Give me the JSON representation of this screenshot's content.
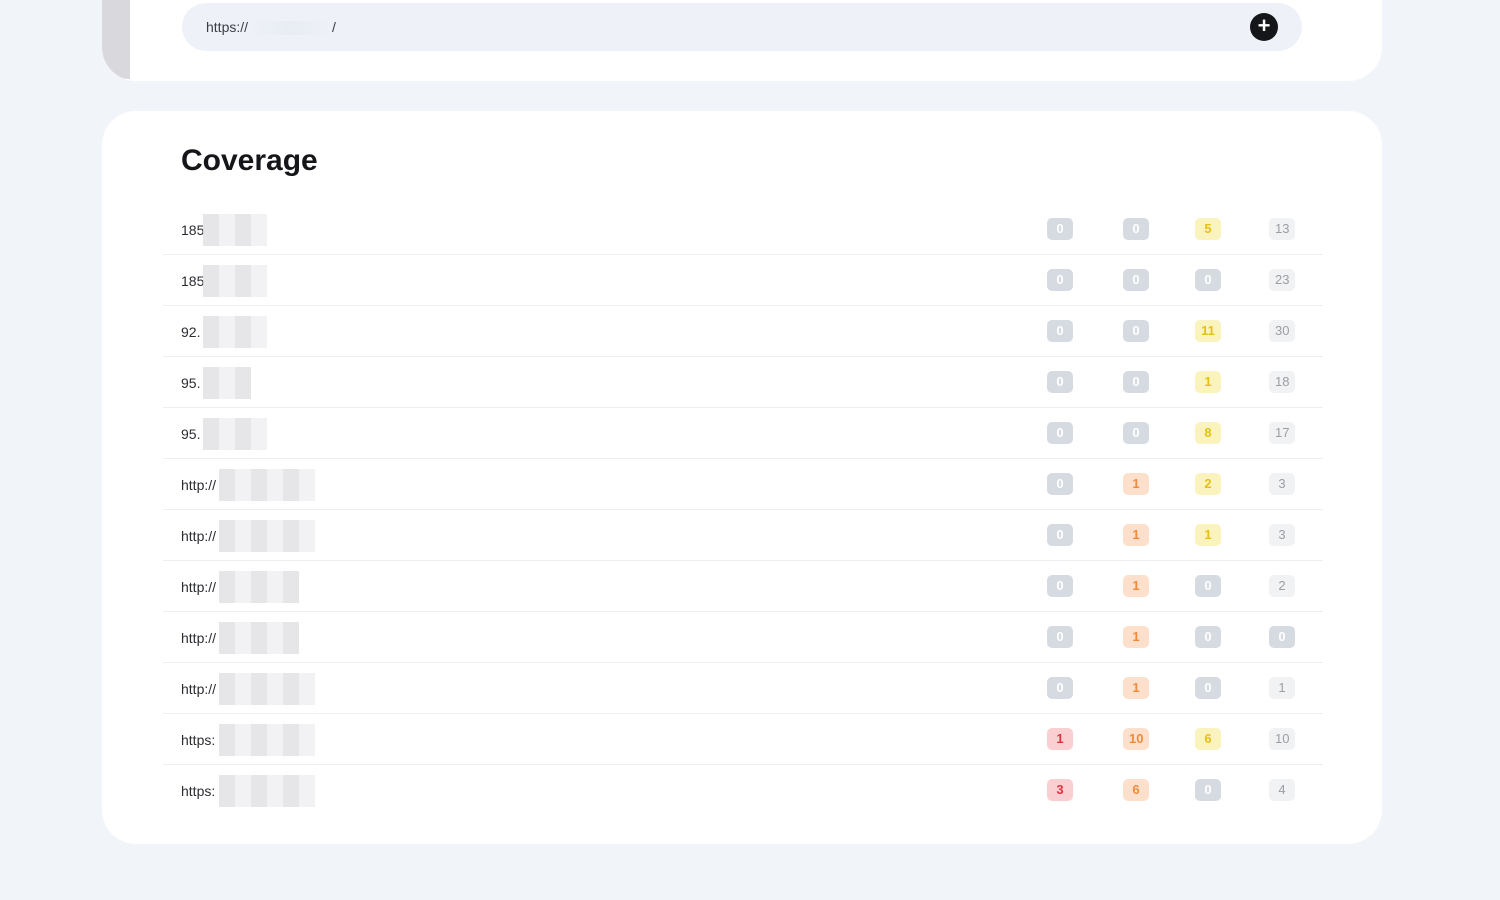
{
  "top": {
    "url_prefix": "https://",
    "url_suffix": "/",
    "add_button": "+"
  },
  "coverage": {
    "title": "Coverage",
    "rows": [
      {
        "label": "185",
        "c1": "0",
        "c2": "0",
        "c3": "5",
        "c4": "13",
        "t1": "gray",
        "t2": "gray",
        "t3": "yellow",
        "t4": "light"
      },
      {
        "label": "185",
        "c1": "0",
        "c2": "0",
        "c3": "0",
        "c4": "23",
        "t1": "gray",
        "t2": "gray",
        "t3": "gray",
        "t4": "light"
      },
      {
        "label": "92.",
        "c1": "0",
        "c2": "0",
        "c3": "11",
        "c4": "30",
        "t1": "gray",
        "t2": "gray",
        "t3": "yellow",
        "t4": "light"
      },
      {
        "label": "95.",
        "c1": "0",
        "c2": "0",
        "c3": "1",
        "c4": "18",
        "t1": "gray",
        "t2": "gray",
        "t3": "yellow",
        "t4": "light"
      },
      {
        "label": "95.",
        "c1": "0",
        "c2": "0",
        "c3": "8",
        "c4": "17",
        "t1": "gray",
        "t2": "gray",
        "t3": "yellow",
        "t4": "light"
      },
      {
        "label": "http://",
        "c1": "0",
        "c2": "1",
        "c3": "2",
        "c4": "3",
        "t1": "gray",
        "t2": "orange",
        "t3": "yellow",
        "t4": "light"
      },
      {
        "label": "http://",
        "c1": "0",
        "c2": "1",
        "c3": "1",
        "c4": "3",
        "t1": "gray",
        "t2": "orange",
        "t3": "yellow",
        "t4": "light"
      },
      {
        "label": "http://",
        "c1": "0",
        "c2": "1",
        "c3": "0",
        "c4": "2",
        "t1": "gray",
        "t2": "orange",
        "t3": "gray",
        "t4": "light"
      },
      {
        "label": "http://",
        "c1": "0",
        "c2": "1",
        "c3": "0",
        "c4": "0",
        "t1": "gray",
        "t2": "orange",
        "t3": "gray",
        "t4": "gray"
      },
      {
        "label": "http://",
        "c1": "0",
        "c2": "1",
        "c3": "0",
        "c4": "1",
        "t1": "gray",
        "t2": "orange",
        "t3": "gray",
        "t4": "light"
      },
      {
        "label": "https:",
        "c1": "1",
        "c2": "10",
        "c3": "6",
        "c4": "10",
        "t1": "red",
        "t2": "orange",
        "t3": "yellow",
        "t4": "light"
      },
      {
        "label": "https:",
        "c1": "3",
        "c2": "6",
        "c3": "0",
        "c4": "4",
        "t1": "red",
        "t2": "orange",
        "t3": "gray",
        "t4": "light"
      }
    ]
  }
}
